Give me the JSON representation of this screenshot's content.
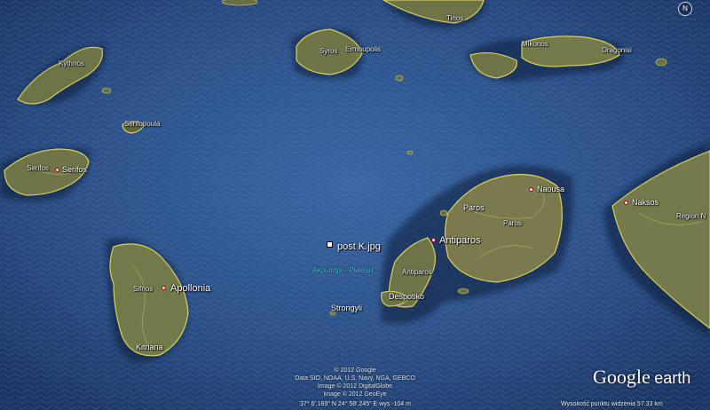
{
  "map": {
    "placemark": "post K.jpg",
    "undersea_feature": "Ακρωτήρι · Plateau",
    "islands": {
      "kythnos": "Kythnos",
      "serifopoula": "Serifopoula",
      "serifos": "Serifos",
      "sifnos": "Sifnos",
      "apollonia": "Apollonia",
      "kitriana": "Kitriana",
      "syros": "Syros",
      "ermoupolis": "Ermoupolis",
      "tinos": "Tinos",
      "mykonos": "Mikonos",
      "dragonisi": "Dragonisi",
      "paros": "Paros",
      "paros_region": "Paros",
      "naousa": "Naousa",
      "antiparos": "Antiparos",
      "antiparos_island": "Antiparos",
      "despotiko": "Despotiko",
      "strongyli": "Strongyli",
      "naxos": "Naksos",
      "naxos_region": "Region N"
    },
    "colors": {
      "sea": "#2b4f85",
      "land": "#6d7447",
      "coast": "#d9cf5a"
    }
  },
  "attribution": [
    "© 2012 Google",
    "Data SIO, NOAA, U.S. Navy, NGA, GEBCO",
    "Image © 2012 DigitalGlobe",
    "Image © 2012 GeoEye"
  ],
  "status": {
    "coordinates": "37° 6'.169\" N  24° 58'.245\" E  wys   -104 m",
    "eye_altitude": "Wysokość punktu widzenia    57.33 km"
  },
  "logo": {
    "google": "Google",
    "earth": "earth"
  },
  "compass": "N"
}
